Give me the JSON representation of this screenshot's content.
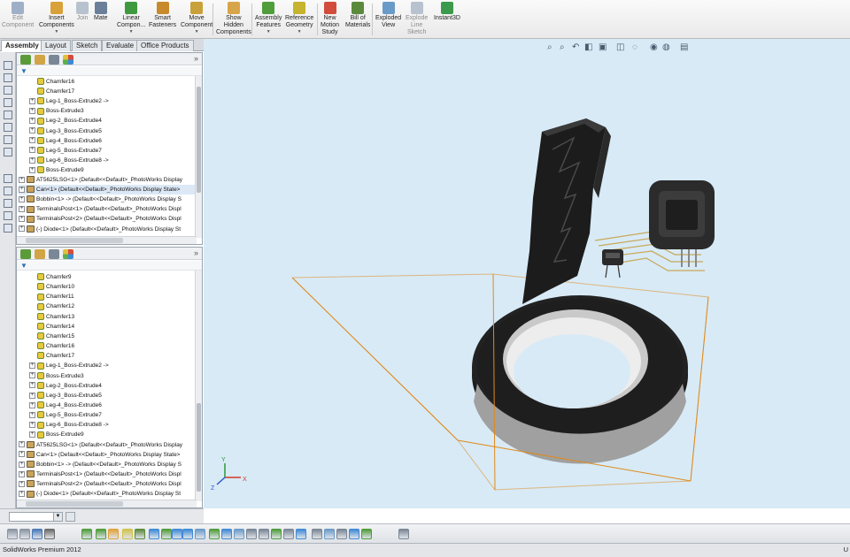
{
  "ribbon": {
    "buttons": [
      {
        "label": "Edit\nComponent",
        "dim": true,
        "color": "#9fb0c6",
        "dropdown": false
      },
      {
        "label": "Insert\nComponents",
        "dim": false,
        "color": "#d9a13a",
        "dropdown": true
      },
      {
        "label": "Join",
        "dim": true,
        "color": "#b8c2cf",
        "dropdown": false
      },
      {
        "label": "Mate",
        "dim": false,
        "color": "#6a7f99",
        "dropdown": false
      },
      {
        "label": "Linear\nCompon...",
        "dim": false,
        "color": "#3f9a3f",
        "dropdown": true
      },
      {
        "label": "Smart\nFasteners",
        "dim": false,
        "color": "#c98a2c",
        "dropdown": false
      },
      {
        "label": "Move\nComponent",
        "dim": false,
        "color": "#c9a13a",
        "dropdown": true
      },
      {
        "label": "Show\nHidden\nComponents",
        "dim": false,
        "color": "#d8a54a",
        "dropdown": false
      },
      {
        "label": "Assembly\nFeatures",
        "dim": false,
        "color": "#4f9d3b",
        "dropdown": true
      },
      {
        "label": "Reference\nGeometry",
        "dim": false,
        "color": "#c6b32e",
        "dropdown": true
      },
      {
        "label": "New\nMotion\nStudy",
        "dim": false,
        "color": "#d14c3a",
        "dropdown": false
      },
      {
        "label": "Bill of\nMaterials",
        "dim": false,
        "color": "#5b8a3c",
        "dropdown": false
      },
      {
        "label": "Exploded\nView",
        "dim": false,
        "color": "#6a9ac8",
        "dropdown": false
      },
      {
        "label": "Explode\nLine\nSketch",
        "dim": true,
        "color": "#b8c2cf",
        "dropdown": false
      },
      {
        "label": "Instant3D",
        "dim": false,
        "color": "#3c9a4c",
        "dropdown": false
      }
    ]
  },
  "tabs": [
    "Assembly",
    "Layout",
    "Sketch",
    "Evaluate",
    "Office Products"
  ],
  "active_tab": "Assembly",
  "tree_top": {
    "rows": [
      {
        "label": "Chamfer16",
        "type": "feature",
        "expandable": false
      },
      {
        "label": "Chamfer17",
        "type": "feature",
        "expandable": false
      },
      {
        "label": "Leg-1_Boss-Extrude2 ->",
        "type": "feature",
        "expandable": true
      },
      {
        "label": "Boss-Extrude3",
        "type": "feature",
        "expandable": true
      },
      {
        "label": "Leg-2_Boss-Extrude4",
        "type": "feature",
        "expandable": true
      },
      {
        "label": "Leg-3_Boss-Extrude5",
        "type": "feature",
        "expandable": true
      },
      {
        "label": "Leg-4_Boss-Extrude6",
        "type": "feature",
        "expandable": true
      },
      {
        "label": "Leg-5_Boss-Extrude7",
        "type": "feature",
        "expandable": true
      },
      {
        "label": "Leg-6_Boss-Extrude8 ->",
        "type": "feature",
        "expandable": true
      },
      {
        "label": "Boss-Extrude9",
        "type": "feature",
        "expandable": true
      },
      {
        "label": "AT5625LSG<1> (Default<<Default>_PhotoWorks Display",
        "type": "component",
        "expandable": true
      },
      {
        "label": "Can<1> (Default<<Default>_PhotoWorks Display State>",
        "type": "component",
        "expandable": true,
        "highlight": true
      },
      {
        "label": "Bobbin<1> -> (Default<<Default>_PhotoWorks Display S",
        "type": "component",
        "expandable": true
      },
      {
        "label": "TerminalsPost<1> (Default<<Default>_PhotoWorks Displ",
        "type": "component",
        "expandable": true
      },
      {
        "label": "TerminalsPost<2> (Default<<Default>_PhotoWorks Displ",
        "type": "component",
        "expandable": true
      },
      {
        "label": "(-) Diode<1> (Default<<Default>_PhotoWorks Display St",
        "type": "component",
        "expandable": true
      }
    ]
  },
  "tree_bottom": {
    "rows": [
      {
        "label": "Chamfer9",
        "type": "feature",
        "expandable": false
      },
      {
        "label": "Chamfer10",
        "type": "feature",
        "expandable": false
      },
      {
        "label": "Chamfer11",
        "type": "feature",
        "expandable": false
      },
      {
        "label": "Chamfer12",
        "type": "feature",
        "expandable": false
      },
      {
        "label": "Chamfer13",
        "type": "feature",
        "expandable": false
      },
      {
        "label": "Chamfer14",
        "type": "feature",
        "expandable": false
      },
      {
        "label": "Chamfer15",
        "type": "feature",
        "expandable": false
      },
      {
        "label": "Chamfer16",
        "type": "feature",
        "expandable": false
      },
      {
        "label": "Chamfer17",
        "type": "feature",
        "expandable": false
      },
      {
        "label": "Leg-1_Boss-Extrude2 ->",
        "type": "feature",
        "expandable": true
      },
      {
        "label": "Boss-Extrude3",
        "type": "feature",
        "expandable": true
      },
      {
        "label": "Leg-2_Boss-Extrude4",
        "type": "feature",
        "expandable": true
      },
      {
        "label": "Leg-3_Boss-Extrude5",
        "type": "feature",
        "expandable": true
      },
      {
        "label": "Leg-4_Boss-Extrude6",
        "type": "feature",
        "expandable": true
      },
      {
        "label": "Leg-5_Boss-Extrude7",
        "type": "feature",
        "expandable": true
      },
      {
        "label": "Leg-6_Boss-Extrude8 ->",
        "type": "feature",
        "expandable": true
      },
      {
        "label": "Boss-Extrude9",
        "type": "feature",
        "expandable": true
      },
      {
        "label": "AT5625LSG<1> (Default<<Default>_PhotoWorks Display",
        "type": "component",
        "expandable": true
      },
      {
        "label": "Can<1> (Default<<Default>_PhotoWorks Display State>",
        "type": "component",
        "expandable": true
      },
      {
        "label": "Bobbin<1> -> (Default<<Default>_PhotoWorks Display S",
        "type": "component",
        "expandable": true
      },
      {
        "label": "TerminalsPost<1> (Default<<Default>_PhotoWorks Displ",
        "type": "component",
        "expandable": true
      },
      {
        "label": "TerminalsPost<2> (Default<<Default>_PhotoWorks Displ",
        "type": "component",
        "expandable": true
      },
      {
        "label": "(-) Diode<1> (Default<<Default>_PhotoWorks Display St",
        "type": "component",
        "expandable": true
      }
    ]
  },
  "viewport": {
    "background": "#d8eaf6",
    "headsup_icons": [
      "zoom-to-fit-icon",
      "zoom-to-area-icon",
      "previous-view-icon",
      "section-view-icon",
      "view-orientation-icon",
      "display-style-icon",
      "hide-show-items-icon",
      "edit-appearance-icon",
      "apply-scene-icon",
      "view-settings-icon"
    ],
    "triad_labels": [
      "Y",
      "X",
      "Z"
    ]
  },
  "statusbar": {
    "text": "SolidWorks Premium 2012",
    "right": "U"
  },
  "colors": {
    "bounding_box": "#e08a1a",
    "model_dark": "#1c1c1c",
    "steel": "#d8d8d8"
  }
}
